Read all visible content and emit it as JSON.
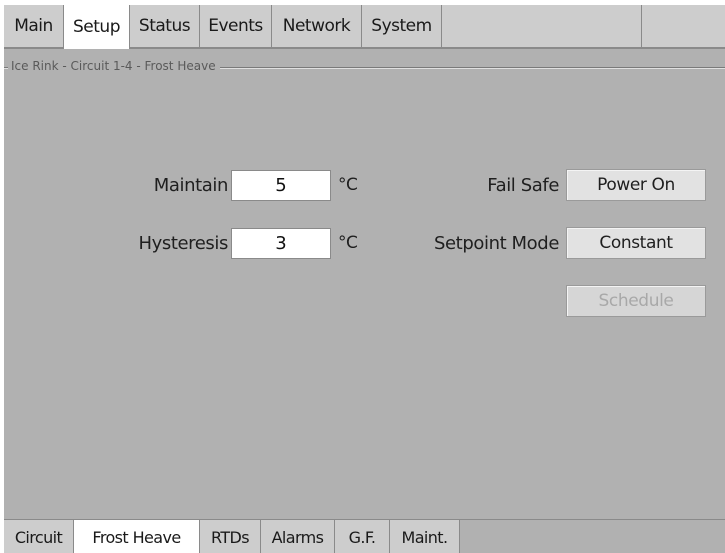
{
  "top_tabs": [
    {
      "label": "Main",
      "active": false
    },
    {
      "label": "Setup",
      "active": true
    },
    {
      "label": "Status",
      "active": false
    },
    {
      "label": "Events",
      "active": false
    },
    {
      "label": "Network",
      "active": false
    },
    {
      "label": "System",
      "active": false
    }
  ],
  "group": {
    "title": "Ice Rink - Circuit 1-4 - Frost Heave"
  },
  "fields": {
    "maintain": {
      "label": "Maintain",
      "value": "5",
      "unit": "°C"
    },
    "hysteresis": {
      "label": "Hysteresis",
      "value": "3",
      "unit": "°C"
    },
    "fail_safe": {
      "label": "Fail Safe",
      "button": "Power On"
    },
    "setpoint_mode": {
      "label": "Setpoint Mode",
      "button": "Constant"
    },
    "schedule": {
      "button": "Schedule",
      "enabled": false
    }
  },
  "bottom_tabs": [
    {
      "label": "Circuit",
      "active": false
    },
    {
      "label": "Frost Heave",
      "active": true
    },
    {
      "label": "RTDs",
      "active": false
    },
    {
      "label": "Alarms",
      "active": false
    },
    {
      "label": "G.F.",
      "active": false
    },
    {
      "label": "Maint.",
      "active": false
    }
  ],
  "colors": {
    "panel_background": "#b1b1b1",
    "tab_background": "#cdcdcd",
    "active_tab": "#ffffff"
  }
}
